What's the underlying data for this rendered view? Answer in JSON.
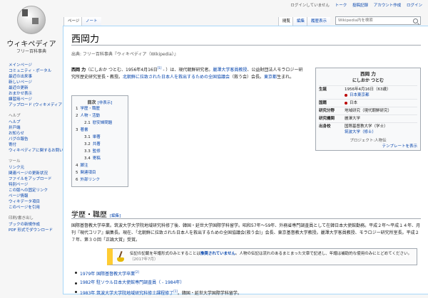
{
  "logo": {
    "wordmark": "ウィキペディア",
    "tagline": "フリー百科事典"
  },
  "personal": {
    "not_logged_in": "ログインしていません",
    "talk": "トーク",
    "contribs": "投稿記録",
    "create_account": "アカウント作成",
    "login": "ログイン"
  },
  "sidebar": {
    "main": [
      "メインページ",
      "コミュニティ・ポータル",
      "最近の出来事",
      "新しいページ",
      "最近の更新",
      "おまかせ表示",
      "練習用ページ",
      "アップロード (ウィキメディア・コモンズ)"
    ],
    "help_head": "ヘルプ",
    "help": [
      "ヘルプ",
      "井戸端",
      "お知らせ",
      "バグの報告",
      "寄付",
      "ウィキペディアに関するお問い合わせ"
    ],
    "tools_head": "ツール",
    "tools": [
      "リンク元",
      "関連ページの更新状況",
      "ファイルをアップロード",
      "特別ページ",
      "この版への固定リンク",
      "ページ情報",
      "ウィキデータ項目",
      "このページを引用"
    ],
    "print_head": "印刷/書き出し",
    "print": [
      "ブックの新規作成",
      "PDF 形式でダウンロード"
    ]
  },
  "tabs": {
    "page": "ページ",
    "note": "ノート",
    "read": "閲覧",
    "edit": "編集",
    "history": "履歴表示"
  },
  "search": {
    "placeholder": "Wikipedia内を検索"
  },
  "article": {
    "title": "西岡力",
    "from": "出典: フリー百科事典『ウィキペディア（Wikipedia）』",
    "lead_name": "西岡 力",
    "lead_1": "（にしおか つとむ、1956年4月16日",
    "lead_ref": "[1]",
    "lead_2": " - ）は、現代朝鮮研究者。",
    "lead_link1": "麗澤大学客員教授",
    "lead_3": "、公益財団法人モラロジー研究所歴史研究室長・教授。",
    "lead_link2": "北朝鮮に拉致された日本人を救出するための全国協議会",
    "lead_4": "（救う会）会長。",
    "lead_link3": "東京都",
    "lead_5": "生まれ。"
  },
  "toc": {
    "title": "目次",
    "hide": "[非表示]",
    "items": [
      {
        "num": "1",
        "label": "学歴・職歴",
        "level": 1
      },
      {
        "num": "2",
        "label": "人物・活動",
        "level": 1
      },
      {
        "num": "2.1",
        "label": "慰安婦問題",
        "level": 2
      },
      {
        "num": "3",
        "label": "著書",
        "level": 1
      },
      {
        "num": "3.1",
        "label": "単著",
        "level": 2
      },
      {
        "num": "3.2",
        "label": "共著",
        "level": 2
      },
      {
        "num": "3.3",
        "label": "監修",
        "level": 2
      },
      {
        "num": "3.4",
        "label": "寄稿",
        "level": 2
      },
      {
        "num": "4",
        "label": "脚注",
        "level": 1
      },
      {
        "num": "5",
        "label": "関連項目",
        "level": 1
      },
      {
        "num": "6",
        "label": "外部リンク",
        "level": 1
      }
    ]
  },
  "infobox": {
    "name": "西岡 力",
    "kana": "にしおか つとむ",
    "rows": [
      {
        "k": "生誕",
        "v": "1956年4月16日（63歳）",
        "v2": "日本東京都",
        "dot": true
      },
      {
        "k": "国籍",
        "v": "日本",
        "dot": true
      },
      {
        "k": "研究分野",
        "v": "地域研究（現代朝鮮研究）"
      },
      {
        "k": "研究機関",
        "v": "麗澤大学"
      },
      {
        "k": "出身校",
        "v": "国際基督教大学（学士）",
        "v2": "筑波大学（修士）"
      }
    ],
    "footer": "プロジェクト:人物伝",
    "footer2": "テンプレートを表示"
  },
  "section": {
    "title": "学歴・職歴",
    "edit": "[編集]",
    "body": "国際基督教大学卒業。筑波大学大学院地域研究科修了後、韓国・延世大学国際学科留学。昭和57年～59年、外務省専門調査員として在韓日本大使館勤務。平成２年～平成１４年、月刊『現代コリア』編集長。現在、「北朝鮮に拉致された日本人を救出するための全国協議会(救う会)」会長、東京基督教大学教授。麗澤大学客員教授、モラロジー研究所室長。平成２７年、第３０回「正論大賞」受賞。"
  },
  "notice": {
    "text_a": "伝記の記載を年譜形式のみとすることは",
    "text_link": "推奨されていません",
    "text_b": "。人物の伝記は流れのあるまとまった文章で記述し、年譜は補助的な使用のみにとどめてください。",
    "date": "（2017年7月）"
  },
  "list": [
    {
      "text": "1979年 国際基督教大学卒業",
      "ref": "[2]"
    },
    {
      "text": "1982年 駐ソウル日本大使館専門調査員（ - 1984年）",
      "ref": ""
    },
    {
      "text": "1983年 筑波大学大学院地域研究科修士課程修了",
      "ref": "[1]",
      "tail": "。韓国・延世大学国際学科留学。"
    }
  ]
}
